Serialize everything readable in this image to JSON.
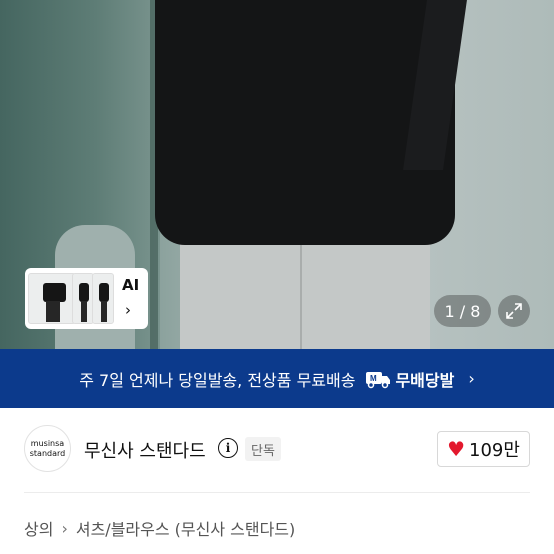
{
  "hero": {
    "ai_label": "AI",
    "counter": "1 / 8"
  },
  "banner": {
    "text": "주 7일 언제나 당일발송, 전상품 무료배송",
    "badge": "무배당발"
  },
  "brand": {
    "logo_line1": "musinsa",
    "logo_line2": "standard",
    "name": "무신사 스탠다드",
    "exclusive_badge": "단독",
    "likes": "109만"
  },
  "breadcrumb": {
    "category": "상의",
    "subcategory": "셔츠/블라우스 (무신사 스탠다드)"
  },
  "colors": {
    "banner_bg": "#0c3a8c",
    "heart": "#e3182d"
  }
}
